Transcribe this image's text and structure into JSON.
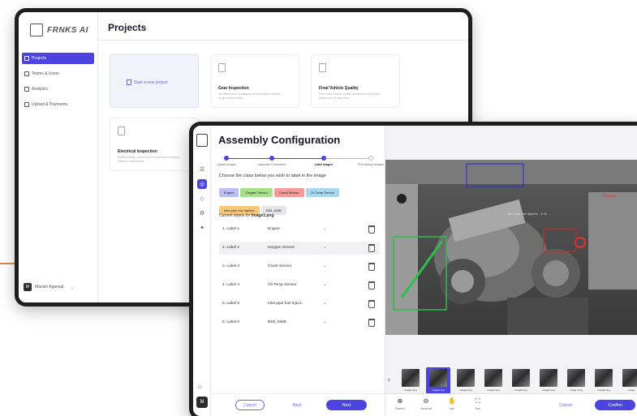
{
  "back_app": {
    "logo_text": "FRNKS AI",
    "page_title": "Projects",
    "nav": [
      {
        "label": "Projects",
        "icon": "grid-icon",
        "active": true
      },
      {
        "label": "Teams & Users",
        "icon": "users-icon",
        "active": false
      },
      {
        "label": "Analytics",
        "icon": "chart-icon",
        "active": false
      },
      {
        "label": "Upload & Payments",
        "icon": "dollar-icon",
        "active": false
      }
    ],
    "user": {
      "initials": "M",
      "name": "Manish Agarwal"
    },
    "new_project_label": "Start a new project",
    "cards": [
      {
        "title": "Gear Inspection",
        "desc": "Identifies wear, misalignment and surface defects on gear assemblies"
      },
      {
        "title": "Final Vehicle Quality",
        "desc": "End-of-line vehicle quality checks covering paint, panels and fit inspection"
      },
      {
        "title": "Electrical Inspection",
        "desc": "Verifies wiring, connectors and harness routing in electrical assemblies"
      }
    ]
  },
  "front_app": {
    "title": "Assembly Configuration",
    "steps": [
      {
        "label": "Upload Images",
        "done": true,
        "current": false
      },
      {
        "label": "Inspection Parameters",
        "done": true,
        "current": false
      },
      {
        "label": "Label Images",
        "done": true,
        "current": true
      },
      {
        "label": "Pre-training analysis",
        "done": false,
        "current": false
      }
    ],
    "choose_text": "Choose the class below you wish to label in the image",
    "chips": [
      {
        "label": "Engine",
        "color": "#b9bff6"
      },
      {
        "label": "Oxygen Sensor",
        "color": "#a6e08b"
      },
      {
        "label": "Crank Sensor",
        "color": "#f49a9a"
      },
      {
        "label": "Oil Temp Sensor",
        "color": "#a8d8f0"
      },
      {
        "label": "Inlet pipe fuel injector",
        "color": "#f6c97a"
      },
      {
        "label": "BS6_KWB",
        "color": "#e6e6ea"
      }
    ],
    "current_labels_prefix": "Current labels for",
    "current_labels_file": "Image1.png",
    "label_rows": [
      {
        "label": "1.  Label 1",
        "value": "Engine"
      },
      {
        "label": "2.  Label 2",
        "value": "Oxygen Sensor"
      },
      {
        "label": "3.  Label 3",
        "value": "Crank Sensor"
      },
      {
        "label": "4.  Label 4",
        "value": "Oil Temp Sensor"
      },
      {
        "label": "5.  Label 5",
        "value": "Inlet pipe fuel inject.."
      },
      {
        "label": "6.  Label 6",
        "value": "BS6_KWB"
      }
    ],
    "buttons": {
      "cancel": "Cancel",
      "back": "Back",
      "next": "Next",
      "cancel_right": "Cancel",
      "confirm": "Confirm"
    },
    "user_initials": "M",
    "annotations": [
      {
        "label": "Inlet pipe fuel injector : 1.00",
        "color": "#2a2acc"
      },
      {
        "label": "Engine",
        "color": "#cc2a2a"
      }
    ],
    "thumbnails": [
      "image1.png",
      "image2.png",
      "image3.png",
      "image4.png",
      "image5.png",
      "image6.png",
      "image7.png",
      "image8.png",
      "image"
    ],
    "active_thumb": 1,
    "tools": [
      {
        "label": "Zoom in",
        "icon": "zoom-in-icon",
        "glyph": "⊕"
      },
      {
        "label": "Zoom out",
        "icon": "zoom-out-icon",
        "glyph": "⊖"
      },
      {
        "label": "pan",
        "icon": "hand-icon",
        "glyph": "✋"
      },
      {
        "label": "box",
        "icon": "box-icon",
        "glyph": "⛶"
      }
    ]
  }
}
